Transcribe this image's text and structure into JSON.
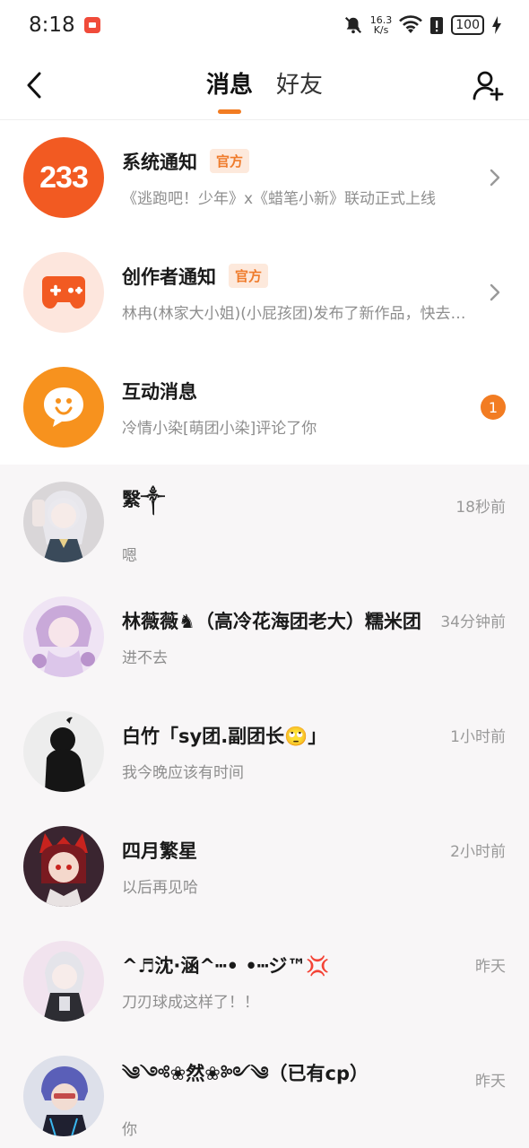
{
  "status_bar": {
    "time": "8:18",
    "net_speed_value": "16.3",
    "net_speed_unit": "K/s",
    "battery": "100"
  },
  "header": {
    "tabs": [
      {
        "label": "消息",
        "active": true
      },
      {
        "label": "好友",
        "active": false
      }
    ]
  },
  "official": [
    {
      "title": "系统通知",
      "badge": "官方",
      "subtitle": "《逃跑吧！少年》x《蜡笔小新》联动正式上线",
      "avatar_text": "233",
      "icon": "233-logo-icon",
      "color": "#f25a22"
    },
    {
      "title": "创作者通知",
      "badge": "官方",
      "subtitle": "林冉(林家大小姐)(小屁孩团)发布了新作品，快去看看吧",
      "icon": "gamepad-icon",
      "color": "#fde6dd"
    },
    {
      "title": "互动消息",
      "subtitle": "冷情小染[萌团小染]评论了你",
      "unread": "1",
      "icon": "chat-bubble-icon",
      "color": "#f7921e"
    }
  ],
  "chats": [
    {
      "name": "繄༒",
      "message": "嗯",
      "time": "18秒前"
    },
    {
      "name": "林薇薇♞（高冷花海团老大）糯米团",
      "message": "进不去",
      "time": "34分钟前"
    },
    {
      "name": "白竹「sy团.副团长🙄」",
      "message": "我今晚应该有时间",
      "time": "1小时前"
    },
    {
      "name": "四月繁星",
      "message": "以后再见哈",
      "time": "2小时前"
    },
    {
      "name": "^♬沈·涵^┅•  •┅ジ™💢",
      "message": "刀刃球成这样了！！",
      "time": "昨天"
    },
    {
      "name": "༄༺❀然❀༻༄（已有cp）",
      "message": "你",
      "time": "昨天"
    }
  ]
}
